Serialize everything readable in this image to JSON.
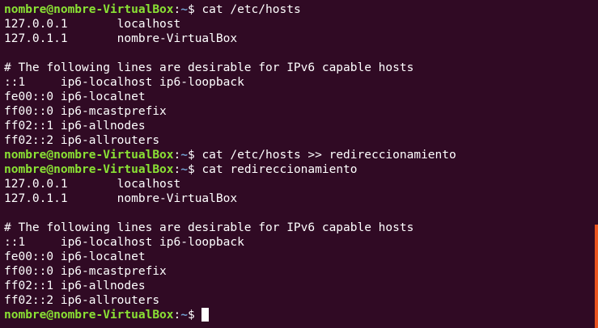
{
  "terminal": {
    "prompt": {
      "user_host": "nombre@nombre-VirtualBox",
      "colon": ":",
      "path": "~",
      "symbol": "$"
    },
    "lines": [
      {
        "type": "cmd",
        "command": "cat /etc/hosts"
      },
      {
        "type": "out",
        "text": "127.0.0.1       localhost"
      },
      {
        "type": "out",
        "text": "127.0.1.1       nombre-VirtualBox"
      },
      {
        "type": "out",
        "text": ""
      },
      {
        "type": "out",
        "text": "# The following lines are desirable for IPv6 capable hosts"
      },
      {
        "type": "out",
        "text": "::1     ip6-localhost ip6-loopback"
      },
      {
        "type": "out",
        "text": "fe00::0 ip6-localnet"
      },
      {
        "type": "out",
        "text": "ff00::0 ip6-mcastprefix"
      },
      {
        "type": "out",
        "text": "ff02::1 ip6-allnodes"
      },
      {
        "type": "out",
        "text": "ff02::2 ip6-allrouters"
      },
      {
        "type": "cmd",
        "command": "cat /etc/hosts >> redireccionamiento"
      },
      {
        "type": "cmd",
        "command": "cat redireccionamiento"
      },
      {
        "type": "out",
        "text": "127.0.0.1       localhost"
      },
      {
        "type": "out",
        "text": "127.0.1.1       nombre-VirtualBox"
      },
      {
        "type": "out",
        "text": ""
      },
      {
        "type": "out",
        "text": "# The following lines are desirable for IPv6 capable hosts"
      },
      {
        "type": "out",
        "text": "::1     ip6-localhost ip6-loopback"
      },
      {
        "type": "out",
        "text": "fe00::0 ip6-localnet"
      },
      {
        "type": "out",
        "text": "ff00::0 ip6-mcastprefix"
      },
      {
        "type": "out",
        "text": "ff02::1 ip6-allnodes"
      },
      {
        "type": "out",
        "text": "ff02::2 ip6-allrouters"
      },
      {
        "type": "prompt",
        "command": ""
      }
    ]
  },
  "colors": {
    "background": "#300a24",
    "text": "#ffffff",
    "prompt_user": "#8ae234",
    "prompt_path": "#729fcf",
    "scrollbar_thumb": "#e95420"
  }
}
